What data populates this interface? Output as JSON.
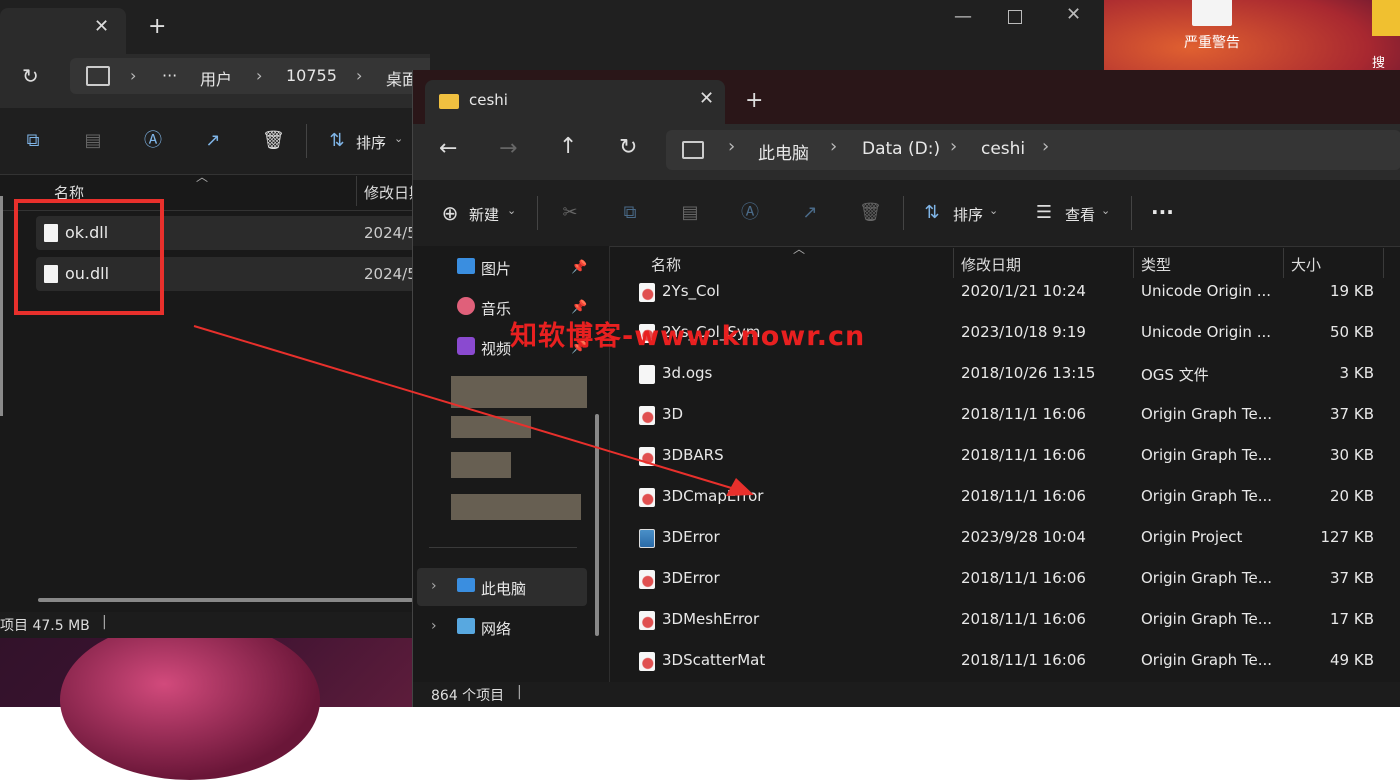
{
  "desktop": {
    "icon1_label": "严重警告",
    "icon2_label": "搜"
  },
  "back_window": {
    "breadcrumb": [
      "用户",
      "10755",
      "桌面"
    ],
    "toolbar": {
      "sort_label": "排序"
    },
    "columns": {
      "name": "名称",
      "modified": "修改日期"
    },
    "files": [
      {
        "name": "ok.dll",
        "date": "2024/5"
      },
      {
        "name": "ou.dll",
        "date": "2024/5"
      }
    ],
    "status": "项目 47.5 MB"
  },
  "front_window": {
    "tab_title": "ceshi",
    "breadcrumb": [
      "此电脑",
      "Data (D:)",
      "ceshi"
    ],
    "toolbar": {
      "new_label": "新建",
      "sort_label": "排序",
      "view_label": "查看"
    },
    "nav": {
      "pictures": "图片",
      "music": "音乐",
      "videos": "视频",
      "this_pc": "此电脑",
      "network": "网络"
    },
    "columns": {
      "name": "名称",
      "modified": "修改日期",
      "type": "类型",
      "size": "大小"
    },
    "files": [
      {
        "name": "2Ys_Col",
        "date": "2020/1/21 10:24",
        "type": "Unicode Origin ...",
        "size": "19 KB",
        "icon": "origin-graph-icon"
      },
      {
        "name": "2Ys_Col_Sym",
        "date": "2023/10/18 9:19",
        "type": "Unicode Origin ...",
        "size": "50 KB",
        "icon": "origin-graph-icon"
      },
      {
        "name": "3d.ogs",
        "date": "2018/10/26 13:15",
        "type": "OGS 文件",
        "size": "3 KB",
        "icon": "plain-file-icon"
      },
      {
        "name": "3D",
        "date": "2018/11/1 16:06",
        "type": "Origin Graph Te...",
        "size": "37 KB",
        "icon": "origin-graph-icon"
      },
      {
        "name": "3DBARS",
        "date": "2018/11/1 16:06",
        "type": "Origin Graph Te...",
        "size": "30 KB",
        "icon": "origin-graph-icon"
      },
      {
        "name": "3DCmapError",
        "date": "2018/11/1 16:06",
        "type": "Origin Graph Te...",
        "size": "20 KB",
        "icon": "origin-graph-icon"
      },
      {
        "name": "3DError",
        "date": "2023/9/28 10:04",
        "type": "Origin Project",
        "size": "127 KB",
        "icon": "origin-project-icon"
      },
      {
        "name": "3DError",
        "date": "2018/11/1 16:06",
        "type": "Origin Graph Te...",
        "size": "37 KB",
        "icon": "origin-graph-icon"
      },
      {
        "name": "3DMeshError",
        "date": "2018/11/1 16:06",
        "type": "Origin Graph Te...",
        "size": "17 KB",
        "icon": "origin-graph-icon"
      },
      {
        "name": "3DScatterMat",
        "date": "2018/11/1 16:06",
        "type": "Origin Graph Te...",
        "size": "49 KB",
        "icon": "origin-graph-icon"
      }
    ],
    "status": "864 个项目"
  },
  "watermark": "知软博客-www.knowr.cn",
  "colors": {
    "highlight_red": "#e8302c",
    "accent_blue": "#7fb4e6",
    "folder_yellow": "#f0c040"
  }
}
